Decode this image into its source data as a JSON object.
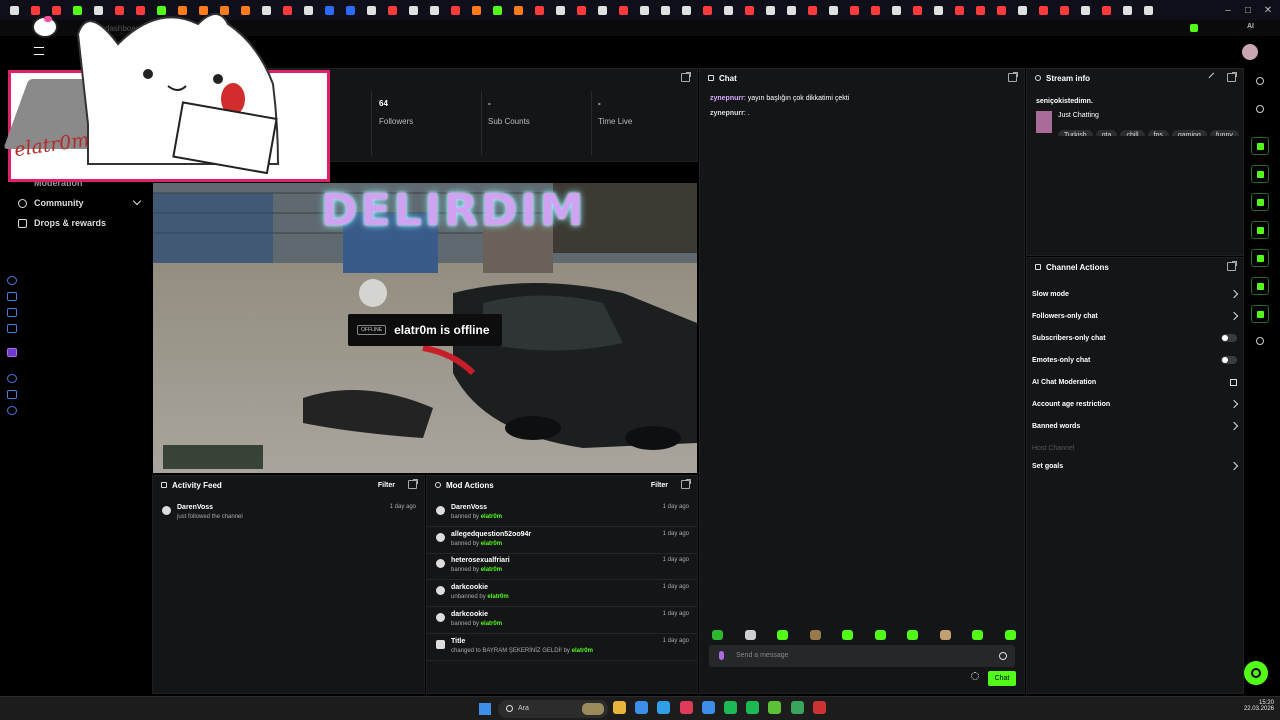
{
  "browser": {
    "address_text": "dashboard.kick.com",
    "tray_label": "AI"
  },
  "tab_colors": [
    "#e0e0e0",
    "#ff3b3b",
    "#ff3b3b",
    "#53fc18",
    "#e0e0e0",
    "#ff3b3b",
    "#ff3b3b",
    "#53fc18",
    "#ff7a1a",
    "#ff7a1a",
    "#ff7a1a",
    "#ff7a1a",
    "#e0e0e0",
    "#ff3b3b",
    "#e0e0e0",
    "#2b6cff",
    "#2b6cff",
    "#e0e0e0",
    "#ff3b3b",
    "#e0e0e0",
    "#e0e0e0",
    "#ff3b3b",
    "#ff7a1a",
    "#53fc18",
    "#ff7a1a",
    "#ff3b3b",
    "#e0e0e0",
    "#ff3b3b",
    "#e0e0e0",
    "#ff3b3b",
    "#e0e0e0",
    "#e0e0e0",
    "#e0e0e0",
    "#ff3b3b",
    "#e0e0e0",
    "#ff3b3b",
    "#e0e0e0",
    "#e0e0e0",
    "#ff3b3b",
    "#e0e0e0",
    "#ff3b3b",
    "#ff3b3b",
    "#e0e0e0",
    "#ff3b3b",
    "#e0e0e0",
    "#ff3b3b",
    "#ff3b3b",
    "#ff3b3b",
    "#e0e0e0",
    "#ff3b3b",
    "#ff3b3b",
    "#e0e0e0",
    "#ff3b3b",
    "#e0e0e0",
    "#e0e0e0"
  ],
  "overlay": {
    "watermark_text": "elatr0m"
  },
  "stats": {
    "followers_value": "64",
    "followers_label": "Followers",
    "subs_value": "-",
    "subs_label": "Sub Counts",
    "time_value": "-",
    "time_label": "Time Live"
  },
  "sidebar": {
    "moderation_label": "Moderation",
    "community_label": "Community",
    "drops_label": "Drops & rewards"
  },
  "video": {
    "offline_badge": "OFFLINE",
    "offline_text": "elatr0m is offline",
    "neon_sign": "DELIRDIM"
  },
  "chat": {
    "title": "Chat",
    "messages": [
      {
        "user": "zynepnurr",
        "text": ": yayın başlığın çok dikkatimi çekti"
      },
      {
        "user": "zynepnurr",
        "text": ": ."
      }
    ],
    "input_placeholder": "Send a message",
    "send_label": "Chat"
  },
  "stream_info": {
    "title": "Stream info",
    "stream_title": "seniçokistedimn.",
    "category": "Just Chatting",
    "tags": [
      "Turkish",
      "gta",
      "chill",
      "fps",
      "gaming",
      "funny"
    ]
  },
  "channel_actions": {
    "title": "Channel Actions",
    "items": [
      {
        "label": "Slow mode",
        "control": "chevron"
      },
      {
        "label": "Followers-only chat",
        "control": "chevron"
      },
      {
        "label": "Subscribers-only chat",
        "control": "toggle"
      },
      {
        "label": "Emotes-only chat",
        "control": "toggle"
      },
      {
        "label": "AI Chat Moderation",
        "control": "external"
      },
      {
        "label": "Account age restriction",
        "control": "chevron"
      },
      {
        "label": "Banned words",
        "control": "chevron"
      },
      {
        "label": "Host Channel",
        "control": "disabled"
      },
      {
        "label": "Set goals",
        "control": "chevron"
      }
    ]
  },
  "activity_feed": {
    "title": "Activity Feed",
    "filter_label": "Filter",
    "items": [
      {
        "name": "DarenVoss",
        "sub": "just followed the channel",
        "time": "1 day ago"
      }
    ]
  },
  "mod_actions": {
    "title": "Mod Actions",
    "filter_label": "Filter",
    "items": [
      {
        "name": "DarenVoss",
        "action": "banned by",
        "by": "elatr0m",
        "time": "1 day ago",
        "icon": "ban-icon"
      },
      {
        "name": "allegedquestion52oo94r",
        "action": "banned by",
        "by": "elatr0m",
        "time": "1 day ago",
        "icon": "ban-icon"
      },
      {
        "name": "heterosexualfriari",
        "action": "banned by",
        "by": "elatr0m",
        "time": "1 day ago",
        "icon": "ban-icon"
      },
      {
        "name": "darkcookie",
        "action": "unbanned by",
        "by": "elatr0m",
        "time": "1 day ago",
        "icon": "unban-icon"
      },
      {
        "name": "darkcookie",
        "action": "banned by",
        "by": "elatr0m",
        "time": "1 day ago",
        "icon": "ban-icon"
      },
      {
        "name": "Title",
        "action": "changed to BAYRAM ŞEKERİNİZ GELDİ! by",
        "by": "elatr0m",
        "time": "1 day ago",
        "icon": "title-icon"
      }
    ]
  },
  "taskbar": {
    "search_placeholder": "Ara",
    "time": "15:20",
    "date": "22.03.2026"
  }
}
